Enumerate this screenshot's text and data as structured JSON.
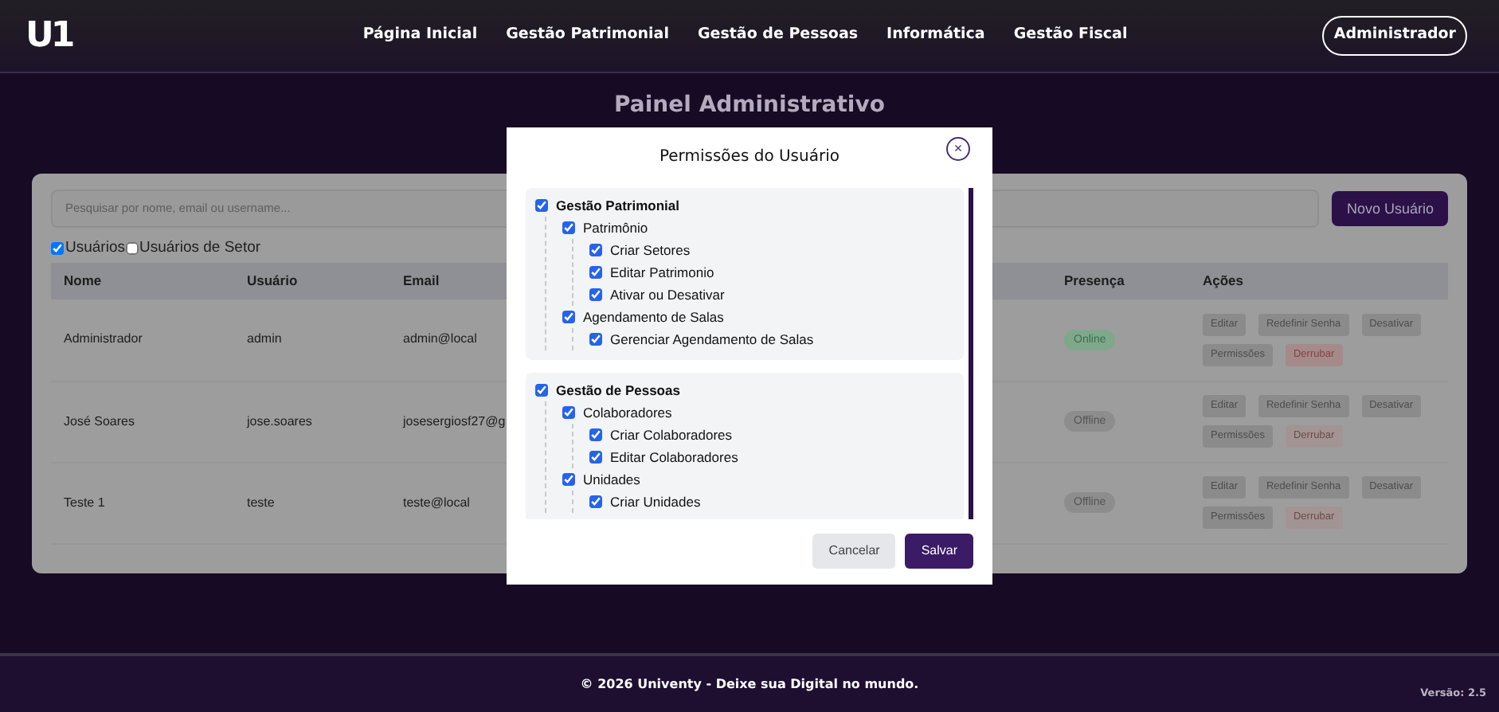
{
  "navbar": {
    "logo": "U1",
    "links": [
      {
        "label": "Página Inicial"
      },
      {
        "label": "Gestão Patrimonial"
      },
      {
        "label": "Gestão de Pessoas"
      },
      {
        "label": "Informática"
      },
      {
        "label": "Gestão Fiscal"
      }
    ],
    "user_button": "Administrador"
  },
  "page_title": "Painel Administrativo",
  "search": {
    "placeholder": "Pesquisar por nome, email ou username..."
  },
  "new_user_button": "Novo Usuário",
  "filters": [
    {
      "label": "Usuários",
      "checked": true
    },
    {
      "label": "Usuários de Setor",
      "checked": false
    }
  ],
  "table": {
    "columns": [
      "Nome",
      "Usuário",
      "Email",
      "Presença",
      "Ações"
    ],
    "rows": [
      {
        "name": "Administrador",
        "username": "admin",
        "email": "admin@local",
        "presence": {
          "label": "Online",
          "kind": "online"
        },
        "actions": [
          {
            "label": "Editar",
            "kind": "plain",
            "disabled": false
          },
          {
            "label": "Redefinir Senha",
            "kind": "plain",
            "disabled": false
          },
          {
            "label": "Desativar",
            "kind": "plain",
            "disabled": false
          },
          {
            "label": "Permissões",
            "kind": "plain",
            "disabled": false
          },
          {
            "label": "Derrubar",
            "kind": "danger",
            "disabled": false
          }
        ]
      },
      {
        "name": "José Soares",
        "username": "jose.soares",
        "email": "josesergiosf27@g",
        "presence": {
          "label": "Offline",
          "kind": "offline"
        },
        "actions": [
          {
            "label": "Editar",
            "kind": "plain",
            "disabled": false
          },
          {
            "label": "Redefinir Senha",
            "kind": "plain",
            "disabled": false
          },
          {
            "label": "Desativar",
            "kind": "plain",
            "disabled": false
          },
          {
            "label": "Permissões",
            "kind": "plain",
            "disabled": false
          },
          {
            "label": "Derrubar",
            "kind": "danger",
            "disabled": true
          }
        ]
      },
      {
        "name": "Teste 1",
        "username": "teste",
        "email": "teste@local",
        "presence": {
          "label": "Offline",
          "kind": "offline"
        },
        "actions": [
          {
            "label": "Editar",
            "kind": "plain",
            "disabled": false
          },
          {
            "label": "Redefinir Senha",
            "kind": "plain",
            "disabled": false
          },
          {
            "label": "Desativar",
            "kind": "plain",
            "disabled": false
          },
          {
            "label": "Permissões",
            "kind": "plain",
            "disabled": false
          },
          {
            "label": "Derrubar",
            "kind": "danger",
            "disabled": true
          }
        ]
      }
    ]
  },
  "modal": {
    "title": "Permissões do Usuário",
    "close": "×",
    "groups": [
      {
        "label": "Gestão Patrimonial",
        "checked": true,
        "children": [
          {
            "label": "Patrimônio",
            "checked": true,
            "children": [
              {
                "label": "Criar Setores",
                "checked": true
              },
              {
                "label": "Editar Patrimonio",
                "checked": true
              },
              {
                "label": "Ativar ou Desativar",
                "checked": true
              }
            ]
          },
          {
            "label": "Agendamento de Salas",
            "checked": true,
            "children": [
              {
                "label": "Gerenciar Agendamento de Salas",
                "checked": true
              }
            ]
          }
        ]
      },
      {
        "label": "Gestão de Pessoas",
        "checked": true,
        "children": [
          {
            "label": "Colaboradores",
            "checked": true,
            "children": [
              {
                "label": "Criar Colaboradores",
                "checked": true
              },
              {
                "label": "Editar Colaboradores",
                "checked": true
              }
            ]
          },
          {
            "label": "Unidades",
            "checked": true,
            "children": [
              {
                "label": "Criar Unidades",
                "checked": true
              }
            ]
          }
        ]
      }
    ],
    "buttons": [
      {
        "label": "Cancelar",
        "kind": "secondary"
      },
      {
        "label": "Salvar",
        "kind": "primary"
      }
    ]
  },
  "footer": {
    "text": "© 2026 Univenty - Deixe sua Digital no mundo.",
    "version": "Versão: 2.5"
  }
}
